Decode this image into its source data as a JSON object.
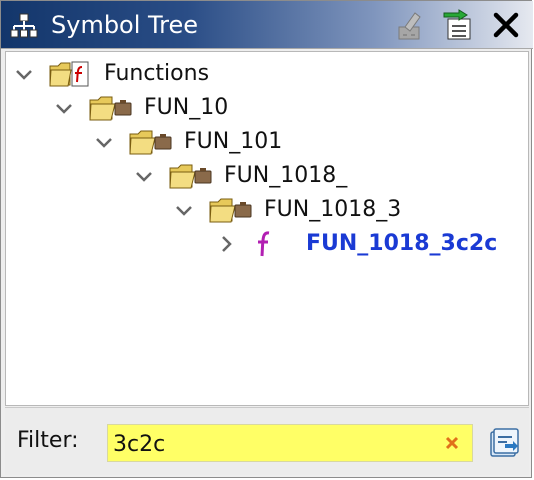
{
  "window": {
    "title": "Symbol Tree",
    "icons": [
      "symbol-tree-icon",
      "disabled-edit-icon",
      "navigate-icon",
      "close-icon"
    ]
  },
  "tree": {
    "nodes": [
      {
        "label": "Functions",
        "level": 0,
        "expanded": true,
        "icon": "functions-folder-icon"
      },
      {
        "label": "FUN_10",
        "level": 1,
        "expanded": true,
        "icon": "folder-icon"
      },
      {
        "label": "FUN_101",
        "level": 2,
        "expanded": true,
        "icon": "folder-icon"
      },
      {
        "label": "FUN_1018_",
        "level": 3,
        "expanded": true,
        "icon": "folder-icon"
      },
      {
        "label": "FUN_1018_3",
        "level": 4,
        "expanded": true,
        "icon": "folder-icon"
      },
      {
        "label": "FUN_1018_3c2c",
        "level": 5,
        "expanded": false,
        "icon": "function-icon",
        "highlight_color": "#1a3ad4"
      }
    ]
  },
  "filter": {
    "label": "Filter:",
    "value": "3c2c",
    "background": "#ffff66"
  }
}
